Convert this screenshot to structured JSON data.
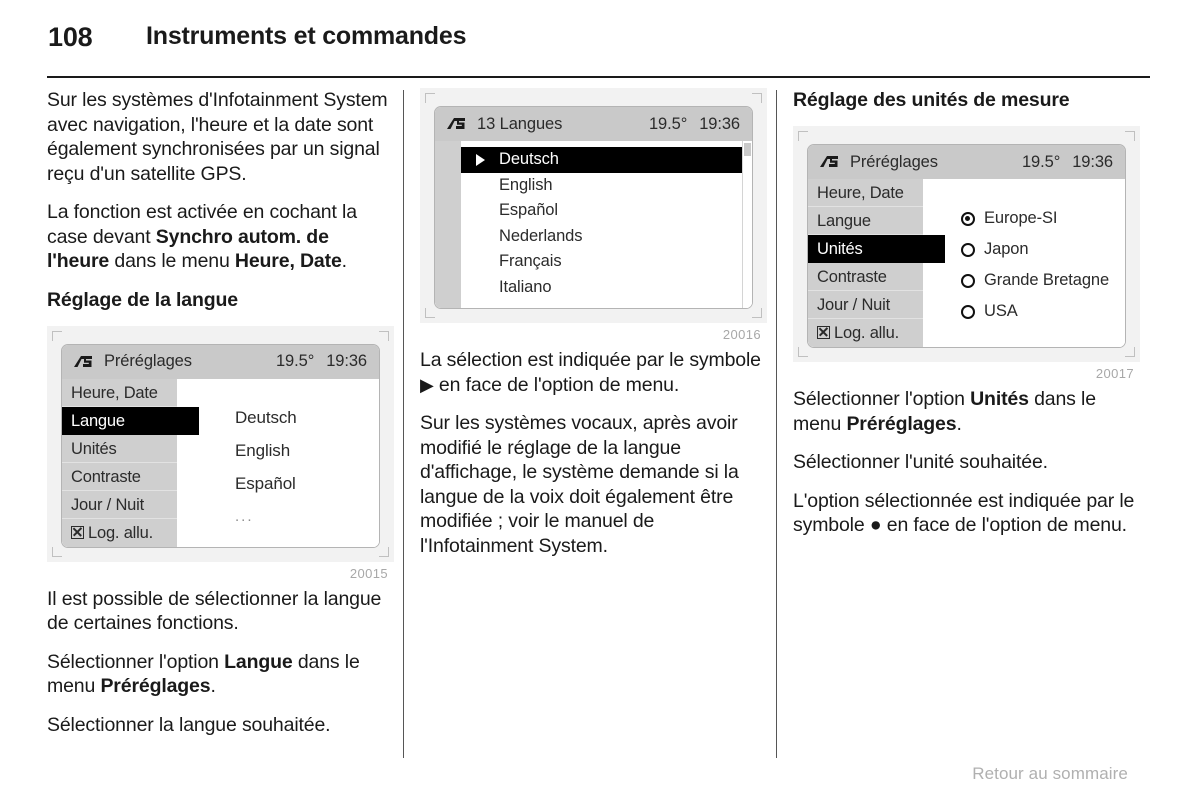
{
  "header": {
    "page_number": "108",
    "title": "Instruments et commandes"
  },
  "footer": {
    "back_link": "Retour au sommaire"
  },
  "column1": {
    "para1": "Sur les systèmes d'Infotainment System avec navigation, l'heure et la date sont également synchronisées par un signal reçu d'un satellite GPS.",
    "para2_a": "La fonction est activée en cochant la case devant ",
    "para2_b": "Synchro autom. de l'heure",
    "para2_c": " dans le menu ",
    "para2_d": "Heure, Date",
    "para2_e": ".",
    "heading": "Réglage de la langue",
    "figure": {
      "caption": "20015",
      "icon": "infotainment-settings-icon",
      "title": "Préréglages",
      "temperature": "19.5°",
      "time": "19:36",
      "menu_items": [
        {
          "label": "Heure, Date",
          "selected": false,
          "checkbox": false
        },
        {
          "label": "Langue",
          "selected": true,
          "checkbox": false
        },
        {
          "label": "Unités",
          "selected": false,
          "checkbox": false
        },
        {
          "label": "Contraste",
          "selected": false,
          "checkbox": false
        },
        {
          "label": "Jour / Nuit",
          "selected": false,
          "checkbox": false
        },
        {
          "label": "Log. allu.",
          "selected": false,
          "checkbox": true
        }
      ],
      "values": [
        "Deutsch",
        "English",
        "Español",
        "..."
      ]
    },
    "para3": "Il est possible de sélectionner la langue de certaines fonctions.",
    "para4_a": "Sélectionner l'option ",
    "para4_b": "Langue",
    "para4_c": " dans le menu ",
    "para4_d": "Préréglages",
    "para4_e": ".",
    "para5": "Sélectionner la langue souhaitée."
  },
  "column2": {
    "figure": {
      "caption": "20016",
      "icon": "infotainment-settings-icon",
      "title": "13 Langues",
      "temperature": "19.5°",
      "time": "19:36",
      "languages": [
        {
          "label": "Deutsch",
          "selected": true
        },
        {
          "label": "English",
          "selected": false
        },
        {
          "label": "Español",
          "selected": false
        },
        {
          "label": "Nederlands",
          "selected": false
        },
        {
          "label": "Français",
          "selected": false
        },
        {
          "label": "Italiano",
          "selected": false
        }
      ]
    },
    "para1_a": "La sélection est indiquée par le symbole ",
    "para1_symbol": "▶",
    "para1_b": " en face de l'option de menu.",
    "para2": "Sur les systèmes vocaux, après avoir modifié le réglage de la langue d'affichage, le système demande si la langue de la voix doit également être modifiée ; voir le manuel de l'Infotainment System."
  },
  "column3": {
    "heading": "Réglage des unités de mesure",
    "figure": {
      "caption": "20017",
      "icon": "infotainment-settings-icon",
      "title": "Préréglages",
      "temperature": "19.5°",
      "time": "19:36",
      "menu_items": [
        {
          "label": "Heure, Date",
          "selected": false,
          "checkbox": false
        },
        {
          "label": "Langue",
          "selected": false,
          "checkbox": false
        },
        {
          "label": "Unités",
          "selected": true,
          "checkbox": false
        },
        {
          "label": "Contraste",
          "selected": false,
          "checkbox": false
        },
        {
          "label": "Jour / Nuit",
          "selected": false,
          "checkbox": false
        },
        {
          "label": "Log. allu.",
          "selected": false,
          "checkbox": true
        }
      ],
      "options": [
        {
          "label": "Europe-SI",
          "selected": true
        },
        {
          "label": "Japon",
          "selected": false
        },
        {
          "label": "Grande Bretagne",
          "selected": false
        },
        {
          "label": "USA",
          "selected": false
        }
      ]
    },
    "para1_a": "Sélectionner l'option ",
    "para1_b": "Unités",
    "para1_c": " dans le menu ",
    "para1_d": "Préréglages",
    "para1_e": ".",
    "para2": "Sélectionner l'unité souhaitée.",
    "para3_a": "L'option sélectionnée est indiquée par le symbole ",
    "para3_symbol": "●",
    "para3_b": " en face de l'option de menu."
  }
}
